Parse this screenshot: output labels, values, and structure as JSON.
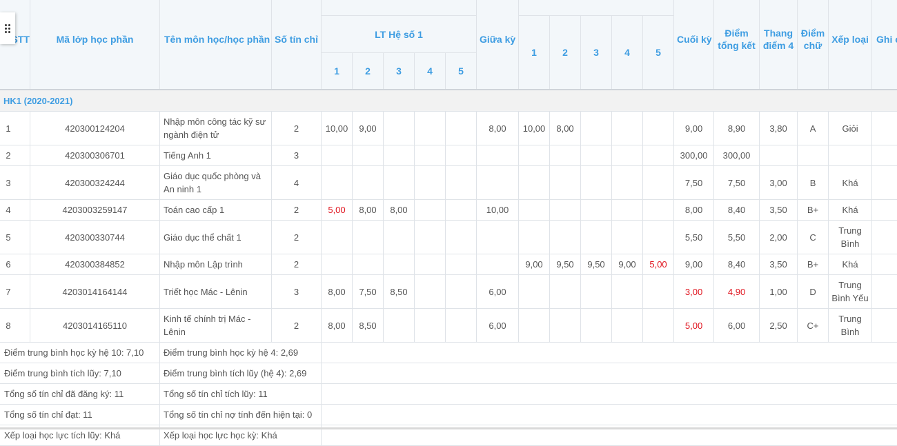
{
  "headers": {
    "stt": "STT",
    "ma_lop": "Mã lớp học phần",
    "ten_mon": "Tên môn học/học phần",
    "so_tin_chi": "Số tín chỉ",
    "lt_he_so": "LT Hệ số 1",
    "giua_ky": "Giữa kỳ",
    "sub_cols": [
      "1",
      "2",
      "3",
      "4",
      "5"
    ],
    "cuoi_ky": "Cuối kỳ",
    "diem_tong_ket": "Điểm tổng kết",
    "thang_diem_4": "Thang điểm 4",
    "diem_chu": "Điểm chữ",
    "xep_loai": "Xếp loại",
    "ghi_chu": "Ghi chú"
  },
  "semester": "HK1 (2020-2021)",
  "rows": [
    {
      "stt": "1",
      "ma": "420300124204",
      "ten": "Nhập môn công tác kỹ sư ngành điện tử",
      "tc": "2",
      "lt": [
        "10,00",
        "9,00",
        "",
        "",
        ""
      ],
      "gk": "8,00",
      "th": [
        "10,00",
        "8,00",
        "",
        "",
        ""
      ],
      "ck": "9,00",
      "tk": "8,90",
      "t4": "3,80",
      "chu": "A",
      "xl": "Giỏi"
    },
    {
      "stt": "2",
      "ma": "420300306701",
      "ten": "Tiếng Anh 1",
      "tc": "3",
      "lt": [
        "",
        "",
        "",
        "",
        ""
      ],
      "gk": "",
      "th": [
        "",
        "",
        "",
        "",
        ""
      ],
      "ck": "300,00",
      "tk": "300,00",
      "t4": "",
      "chu": "",
      "xl": ""
    },
    {
      "stt": "3",
      "ma": "420300324244",
      "ten": "Giáo dục quốc phòng và An ninh 1",
      "tc": "4",
      "lt": [
        "",
        "",
        "",
        "",
        ""
      ],
      "gk": "",
      "th": [
        "",
        "",
        "",
        "",
        ""
      ],
      "ck": "7,50",
      "tk": "7,50",
      "t4": "3,00",
      "chu": "B",
      "xl": "Khá"
    },
    {
      "stt": "4",
      "ma": "4203003259147",
      "ten": "Toán cao cấp 1",
      "tc": "2",
      "lt": [
        "5,00",
        "8,00",
        "8,00",
        "",
        ""
      ],
      "gk": "10,00",
      "th": [
        "",
        "",
        "",
        "",
        ""
      ],
      "ck": "8,00",
      "tk": "8,40",
      "t4": "3,50",
      "chu": "B+",
      "xl": "Khá"
    },
    {
      "stt": "5",
      "ma": "420300330744",
      "ten": "Giáo dục thể chất 1",
      "tc": "2",
      "lt": [
        "",
        "",
        "",
        "",
        ""
      ],
      "gk": "",
      "th": [
        "",
        "",
        "",
        "",
        ""
      ],
      "ck": "5,50",
      "tk": "5,50",
      "t4": "2,00",
      "chu": "C",
      "xl": "Trung Bình"
    },
    {
      "stt": "6",
      "ma": "420300384852",
      "ten": "Nhập môn Lập trình",
      "tc": "2",
      "lt": [
        "",
        "",
        "",
        "",
        ""
      ],
      "gk": "",
      "th": [
        "9,00",
        "9,50",
        "9,50",
        "9,00",
        "5,00"
      ],
      "ck": "9,00",
      "tk": "8,40",
      "t4": "3,50",
      "chu": "B+",
      "xl": "Khá"
    },
    {
      "stt": "7",
      "ma": "4203014164144",
      "ten": "Triết học Mác - Lênin",
      "tc": "3",
      "lt": [
        "8,00",
        "7,50",
        "8,50",
        "",
        ""
      ],
      "gk": "6,00",
      "th": [
        "",
        "",
        "",
        "",
        ""
      ],
      "ck": "3,00",
      "tk": "4,90",
      "t4": "1,00",
      "chu": "D",
      "xl": "Trung Bình Yếu"
    },
    {
      "stt": "8",
      "ma": "4203014165110",
      "ten": "Kinh tế chính trị Mác - Lênin",
      "tc": "2",
      "lt": [
        "8,00",
        "8,50",
        "",
        "",
        ""
      ],
      "gk": "6,00",
      "th": [
        "",
        "",
        "",
        "",
        ""
      ],
      "ck": "5,00",
      "tk": "6,00",
      "t4": "2,50",
      "chu": "C+",
      "xl": "Trung Bình"
    }
  ],
  "summary": [
    {
      "left": "Điểm trung bình học kỳ hệ 10: 7,10",
      "right": "Điểm trung bình học kỳ hệ 4: 2,69"
    },
    {
      "left": "Điểm trung bình tích lũy: 7,10",
      "right": "Điểm trung bình tích lũy (hệ 4): 2,69"
    },
    {
      "left": "Tổng số tín chỉ đã đăng ký: 11",
      "right": "Tổng số tín chỉ tích lũy: 11"
    },
    {
      "left": "Tổng số tín chỉ đạt: 11",
      "right": "Tổng số tín chỉ nợ tính đến hiện tại: 0"
    },
    {
      "left": "Xếp loại học lực tích lũy: Khá",
      "right": "Xếp loại học lực học kỳ: Khá"
    }
  ],
  "colors": {
    "header_text": "#3e9de2",
    "fail_red": "#e0141e",
    "header_bg": "#f3f7fa"
  }
}
